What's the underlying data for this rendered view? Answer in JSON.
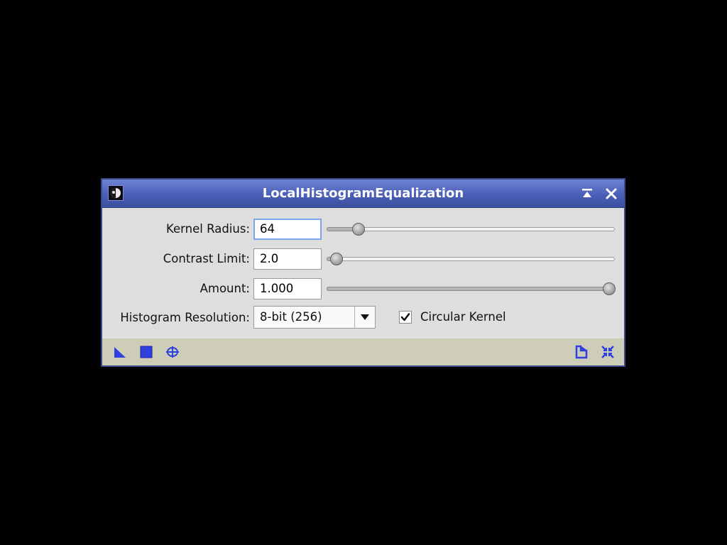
{
  "window": {
    "title": "LocalHistogramEqualization"
  },
  "titlebar": {
    "app_icon": "pixinsight-app-icon",
    "shade_icon": "shade-up-icon",
    "close_icon": "close-icon"
  },
  "params": {
    "kernel_radius": {
      "label": "Kernel Radius:",
      "value": "64",
      "slider_fraction": 0.11
    },
    "contrast_limit": {
      "label": "Contrast Limit:",
      "value": "2.0",
      "slider_fraction": 0.035
    },
    "amount": {
      "label": "Amount:",
      "value": "1.000",
      "slider_fraction": 0.98
    }
  },
  "histogram_resolution": {
    "label": "Histogram Resolution:",
    "selected": "8-bit (256)"
  },
  "circular_kernel": {
    "label": "Circular Kernel",
    "checked": true
  },
  "bottombar": {
    "left_icons": [
      "new-instance-icon",
      "apply-global-icon",
      "real-time-preview-icon"
    ],
    "right_icons": [
      "documentation-icon",
      "reset-icon"
    ]
  },
  "colors": {
    "titlebar": "#4a5fb6",
    "icon_blue": "#2f3fe0",
    "bottombar": "#cdcdb8",
    "focus_border": "#7aa7e8"
  }
}
